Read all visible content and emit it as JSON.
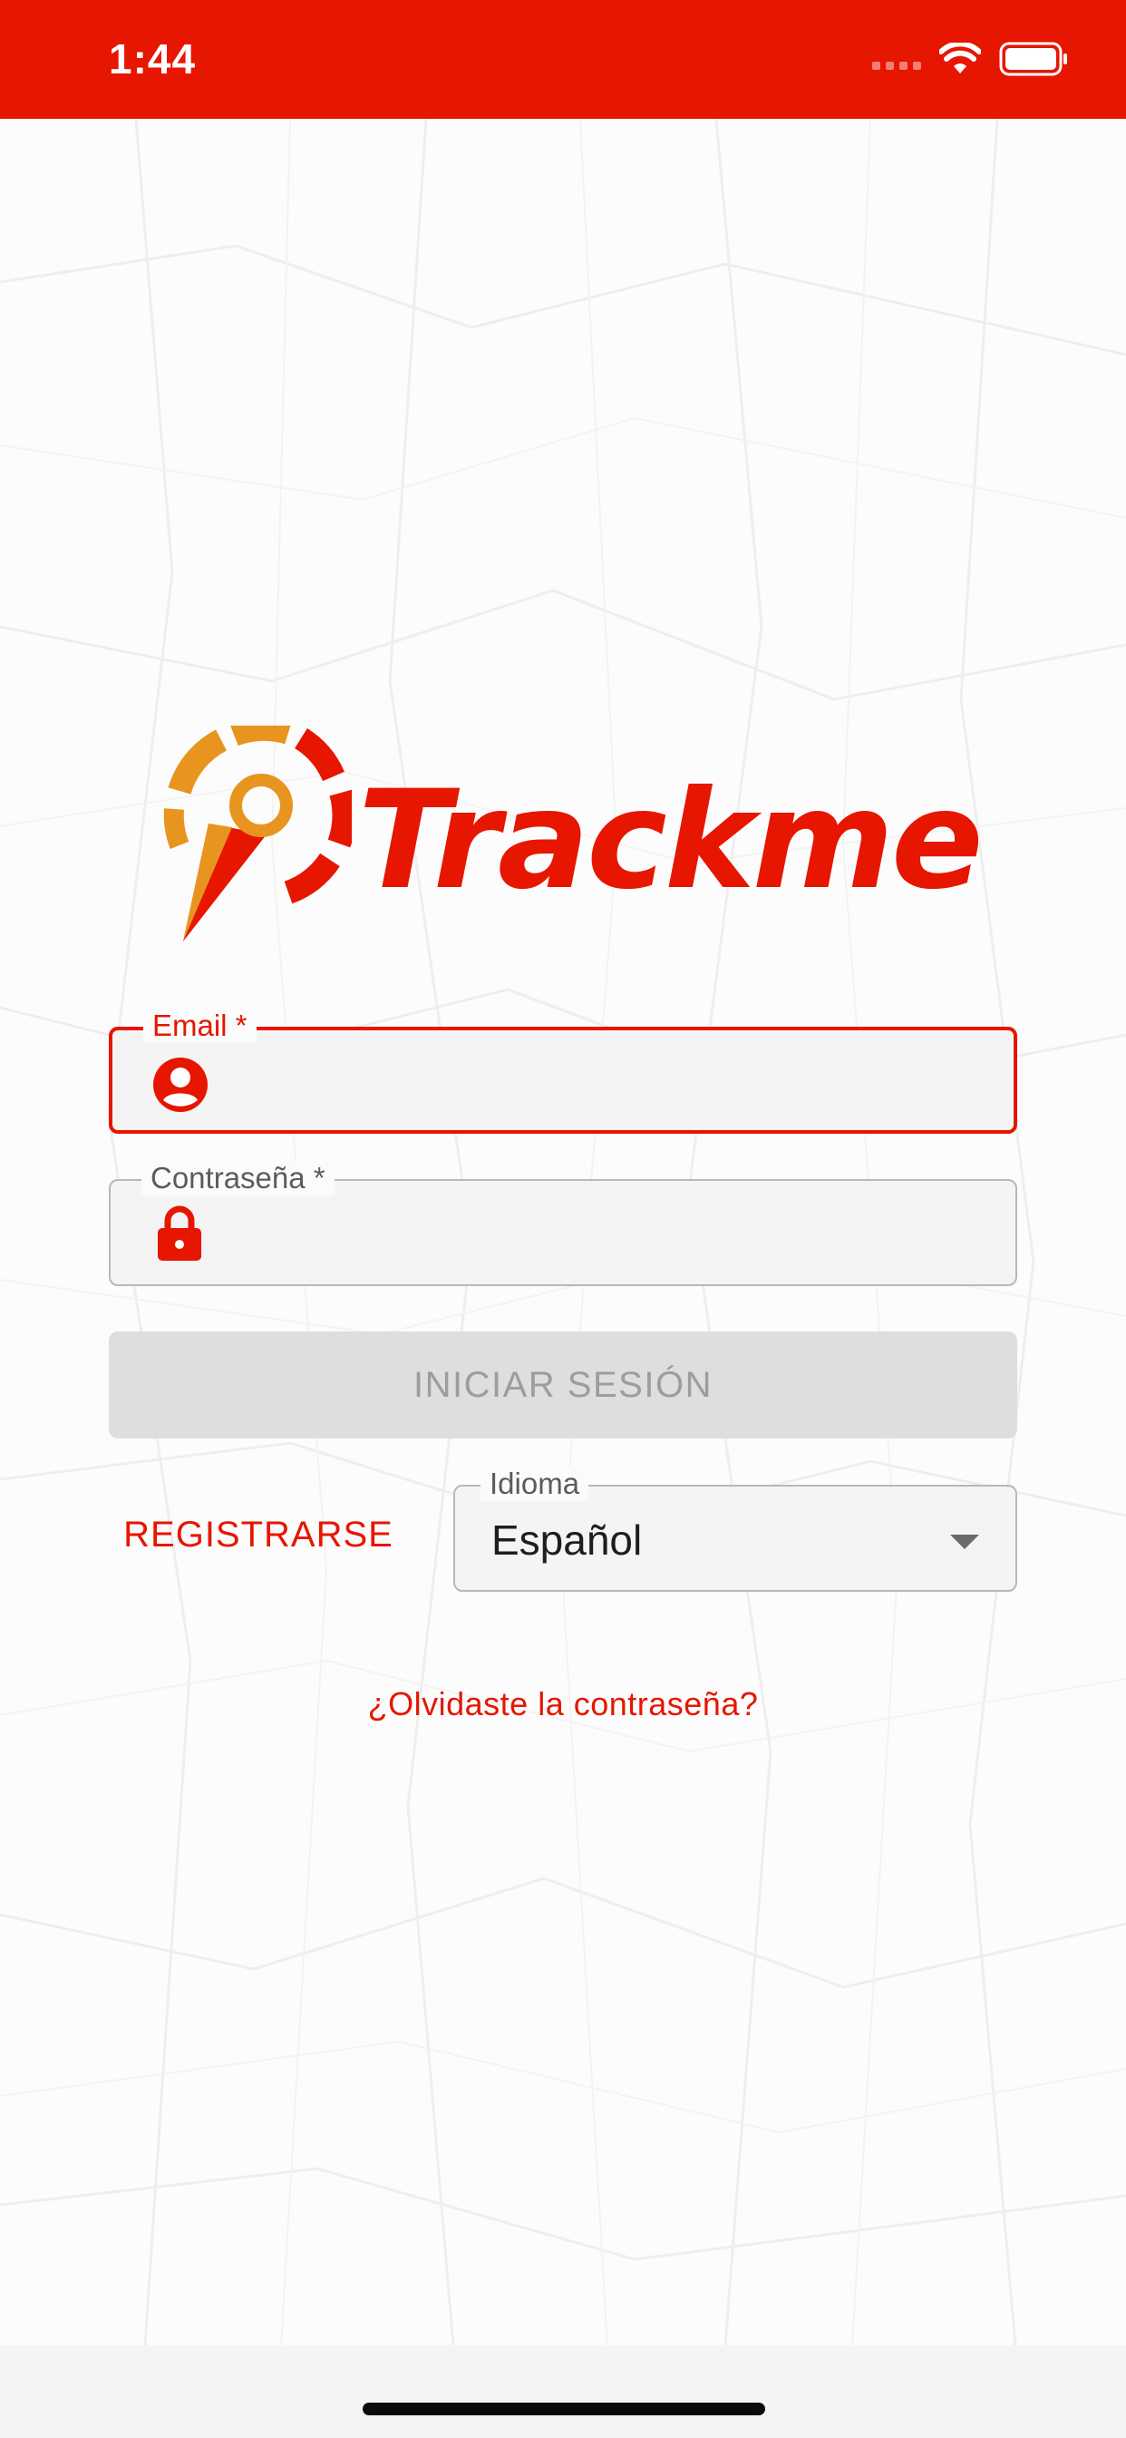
{
  "status_bar": {
    "time": "1:44",
    "bg_color": "#e61600"
  },
  "app": {
    "name": "Trackme",
    "brand_color": "#e61600",
    "accent_color": "#e89520"
  },
  "form": {
    "email": {
      "label": "Email *",
      "value": "",
      "icon": "person-circle-icon"
    },
    "password": {
      "label": "Contraseña *",
      "value": "",
      "icon": "lock-icon"
    },
    "login_button": "INICIAR SESIÓN",
    "register_button": "REGISTRARSE",
    "language": {
      "label": "Idioma",
      "value": "Español"
    },
    "forgot_password": "¿Olvidaste la contraseña?"
  }
}
